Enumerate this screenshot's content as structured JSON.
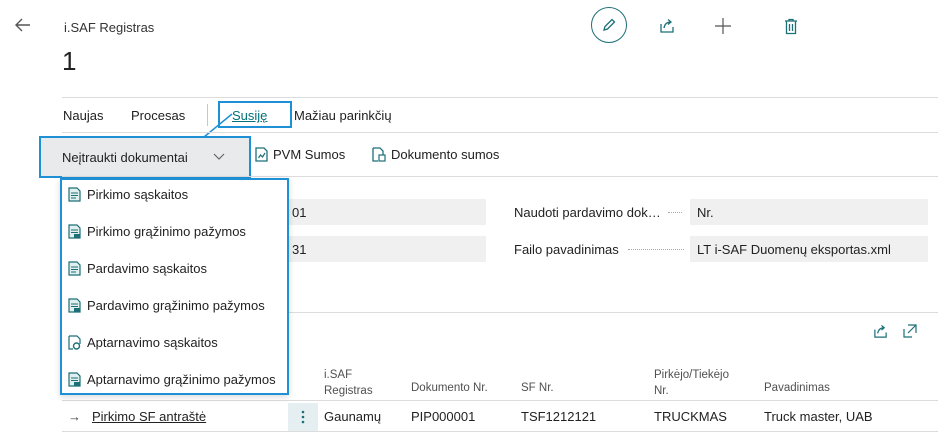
{
  "header": {
    "page_caption": "i.SAF Registras",
    "record_no": "1"
  },
  "tabs": {
    "naujas": "Naujas",
    "procesas": "Procesas",
    "susije": "Susiję",
    "maziau": "Mažiau parinkčių"
  },
  "actions": {
    "nejtraukti": "Neįtraukti dokumentai",
    "pvm_sumos": "PVM Sumos",
    "dokumento_sumos": "Dokumento sumos"
  },
  "menu": {
    "items": [
      "Pirkimo sąskaitos",
      "Pirkimo grąžinimo pažymos",
      "Pardavimo sąskaitos",
      "Pardavimo grąžinimo pažymos",
      "Aptarnavimo sąskaitos",
      "Aptarnavimo grąžinimo pažymos"
    ]
  },
  "fields": {
    "left_value_1": "01",
    "left_value_2": "31",
    "naudoti_label": "Naudoti pardavimo dok…",
    "naudoti_value": "Nr.",
    "failo_label": "Failo pavadinimas",
    "failo_value": "LT i-SAF Duomenų eksportas.xml"
  },
  "grid": {
    "headers": {
      "registras_line1": "i.SAF",
      "registras_line2": "Registras",
      "dokumento_nr": "Dokumento Nr.",
      "sf_nr": "SF Nr.",
      "pirkejo_line1": "Pirkėjo/Tiekėjo",
      "pirkejo_line2": "Nr.",
      "pavadinimas": "Pavadinimas"
    },
    "row": {
      "arrow": "→",
      "name": "Pirkimo SF antraštė",
      "registras": "Gaunamų",
      "dokumento_nr": "PIP000001",
      "sf_nr": "TSF1212121",
      "pirkejo_nr": "TRUCKMAS",
      "pavadinimas": "Truck master, UAB"
    }
  },
  "icons": {
    "back": "back-arrow-icon",
    "edit": "pencil-icon",
    "share": "share-icon",
    "add": "plus-icon",
    "delete": "trash-icon",
    "dropdown": "chevron-down-icon",
    "pvm": "chart-doc-icon",
    "dokumento": "doc-sum-icon",
    "expand": "expand-icon"
  },
  "colors": {
    "accent": "#00707a",
    "highlight": "#1e90d6",
    "selected_bg": "#e8eaec"
  }
}
